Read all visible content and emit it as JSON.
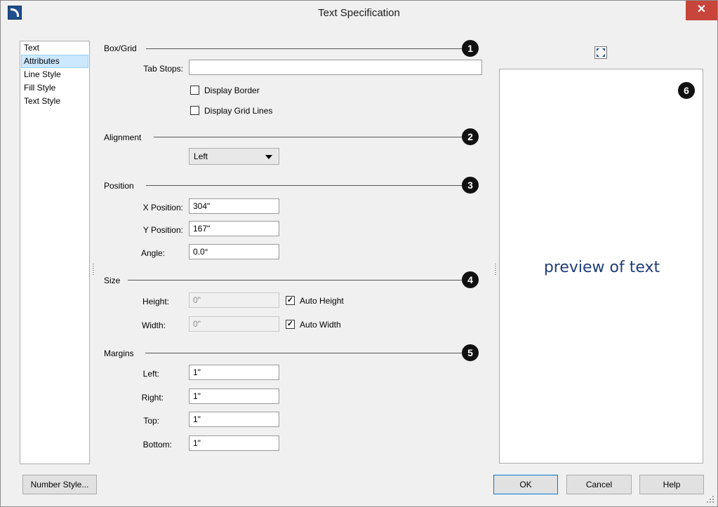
{
  "window": {
    "title": "Text Specification",
    "close_glyph": "✕"
  },
  "nav": {
    "items": [
      {
        "label": "Text"
      },
      {
        "label": "Attributes"
      },
      {
        "label": "Line Style"
      },
      {
        "label": "Fill Style"
      },
      {
        "label": "Text Style"
      }
    ],
    "selected": "Attributes"
  },
  "box_grid": {
    "label": "Box/Grid",
    "badge": "1",
    "tab_stops_label": "Tab Stops:",
    "tab_stops_value": "",
    "display_border_label": "Display Border",
    "display_border_checked": false,
    "display_grid_label": "Display Grid Lines",
    "display_grid_checked": false
  },
  "alignment": {
    "label": "Alignment",
    "badge": "2",
    "selected": "Left"
  },
  "position": {
    "label": "Position",
    "badge": "3",
    "x_label": "X Position:",
    "x_value": "304\"",
    "y_label": "Y Position:",
    "y_value": "167\"",
    "angle_label": "Angle:",
    "angle_value": "0.0°"
  },
  "size": {
    "label": "Size",
    "badge": "4",
    "height_label": "Height:",
    "height_value": "0\"",
    "auto_height_label": "Auto Height",
    "auto_height_checked": true,
    "width_label": "Width:",
    "width_value": "0\"",
    "auto_width_label": "Auto Width",
    "auto_width_checked": true
  },
  "margins": {
    "label": "Margins",
    "badge": "5",
    "left_label": "Left:",
    "left_value": "1\"",
    "right_label": "Right:",
    "right_value": "1\"",
    "top_label": "Top:",
    "top_value": "1\"",
    "bottom_label": "Bottom:",
    "bottom_value": "1\""
  },
  "preview": {
    "badge": "6",
    "text": "preview of text",
    "text_color": "#1f3d78"
  },
  "buttons": {
    "number_style": "Number Style...",
    "ok": "OK",
    "cancel": "Cancel",
    "help": "Help"
  },
  "colors": {
    "close_button": "#c7453b",
    "selection_bg": "#cce8ff",
    "primary_border": "#0078d7"
  }
}
